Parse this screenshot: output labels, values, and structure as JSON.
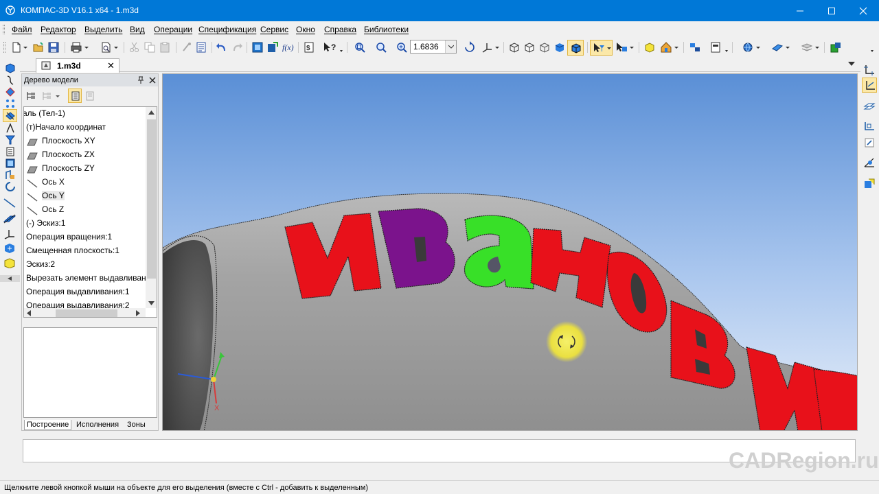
{
  "titlebar": {
    "title": "КОМПАС-3D V16.1 x64 - 1.m3d"
  },
  "menu": [
    "Файл",
    "Редактор",
    "Выделить",
    "Вид",
    "Операции",
    "Спецификация",
    "Сервис",
    "Окно",
    "Справка",
    "Библиотеки"
  ],
  "toolbar": {
    "zoom_value": "1.6836"
  },
  "doc_tab": {
    "label": "1.m3d"
  },
  "tree": {
    "header": "Дерево модели",
    "items": [
      "аль (Тел-1)",
      "(т)Начало координат",
      "Плоскость XY",
      "Плоскость ZX",
      "Плоскость ZY",
      "Ось X",
      "Ось Y",
      "Ось Z",
      "(-) Эскиз:1",
      "Операция вращения:1",
      "Смещенная плоскость:1",
      "Эскиз:2",
      "Вырезать элемент выдавливан",
      "Операция выдавливания:1",
      "Операция выдавливания:2"
    ],
    "tabs": [
      "Построение",
      "Исполнения",
      "Зоны"
    ]
  },
  "viewport": {
    "text_letters": [
      "И",
      "В",
      "а",
      "Н",
      "О",
      "В"
    ],
    "tail_letters": "ИЕ",
    "axis_label": "X",
    "colors": {
      "red": "#e8111a",
      "purple": "#7b138c",
      "green": "#38e028",
      "sky_top": "#5a8fd6",
      "sky_bottom": "#e6eef9"
    }
  },
  "watermark": "CADRegion.ru",
  "status": "Щелкните левой кнопкой мыши на объекте для его выделения (вместе с Ctrl - добавить к выделенным)"
}
